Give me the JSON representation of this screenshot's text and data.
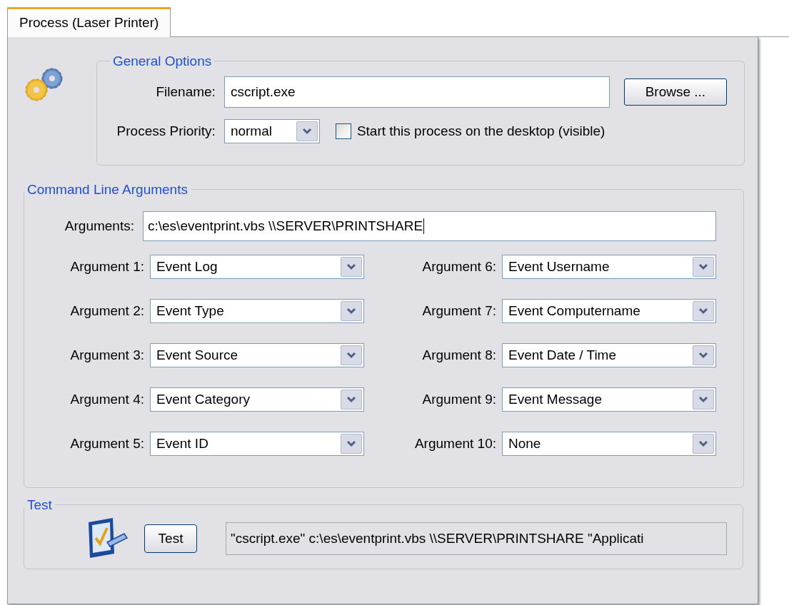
{
  "tab": {
    "label": "Process (Laser Printer)",
    "selected": true
  },
  "general_options": {
    "title": "General Options",
    "filename_label": "Filename:",
    "filename": "cscript.exe",
    "browse_button": "Browse ...",
    "priority_label": "Process Priority:",
    "priority": "normal",
    "visible_checkbox": {
      "label": "Start this process on the desktop (visible)",
      "checked": false
    }
  },
  "command_line": {
    "title": "Command Line Arguments",
    "arguments_label": "Arguments:",
    "arguments": "c:\\es\\eventprint.vbs \\\\SERVER\\PRINTSHARE",
    "argument_fields": [
      {
        "label": "Argument 1:",
        "value": "Event Log"
      },
      {
        "label": "Argument 2:",
        "value": "Event Type"
      },
      {
        "label": "Argument 3:",
        "value": "Event Source"
      },
      {
        "label": "Argument 4:",
        "value": "Event Category"
      },
      {
        "label": "Argument 5:",
        "value": "Event ID"
      },
      {
        "label": "Argument 6:",
        "value": "Event Username"
      },
      {
        "label": "Argument 7:",
        "value": "Event Computername"
      },
      {
        "label": "Argument 8:",
        "value": "Event Date / Time"
      },
      {
        "label": "Argument 9:",
        "value": "Event Message"
      },
      {
        "label": "Argument 10:",
        "value": "None"
      }
    ]
  },
  "test": {
    "title": "Test",
    "button": "Test",
    "output": "\"cscript.exe\" c:\\es\\eventprint.vbs \\\\SERVER\\PRINTSHARE \"Applicati"
  }
}
